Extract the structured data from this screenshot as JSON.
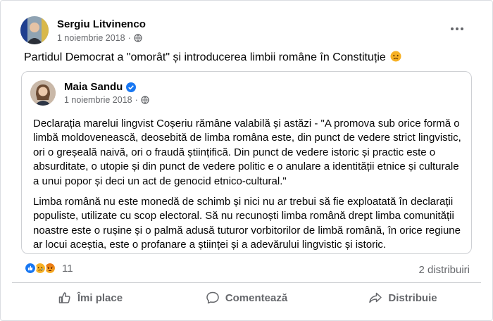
{
  "post": {
    "author": "Sergiu Litvinenco",
    "date": "1 noiembrie 2018",
    "separator": "·",
    "text": "Partidul Democrat a \"omorât\" și introducerea limbii române în Constituție"
  },
  "shared_post": {
    "author": "Maia Sandu",
    "date": "1 noiembrie 2018",
    "separator": "·",
    "paragraph1": "Declarația marelui lingvist Coșeriu rămâne valabilă și astăzi - \"A promova sub orice formă o limbă moldovenească, deosebită de limba româna este, din punct de vedere strict lingvistic, ori o greșeală naivă, ori o fraudă științifică. Din punct de vedere istoric și practic este o absurditate, o utopie și din punct de vedere politic e o anulare a identității etnice și culturale a unui popor și deci un act de genocid etnico-cultural.\"",
    "paragraph2": "Limba română nu este monedă de schimb și nici nu ar trebui să fie exploatată în declarații populiste, utilizate cu scop electoral. Să nu recunoști limba română drept limba comunității noastre este o rușine și o palmă adusă tuturor vorbitorilor de limbă română, în orice regiune ar locui aceștia, este o profanare a științei și a adevărului lingvistic și istoric."
  },
  "stats": {
    "reaction_count": "11",
    "shares": "2 distribuiri",
    "reactions": [
      "like-icon",
      "sad-icon",
      "angry-icon"
    ]
  },
  "actions": {
    "like": "Îmi place",
    "comment": "Comentează",
    "share": "Distribuie"
  },
  "colors": {
    "like_blue": "#1877f2",
    "sad_yellow": "#f7b125",
    "angry_orange": "#e9710f",
    "secondary_text": "#65676b"
  }
}
